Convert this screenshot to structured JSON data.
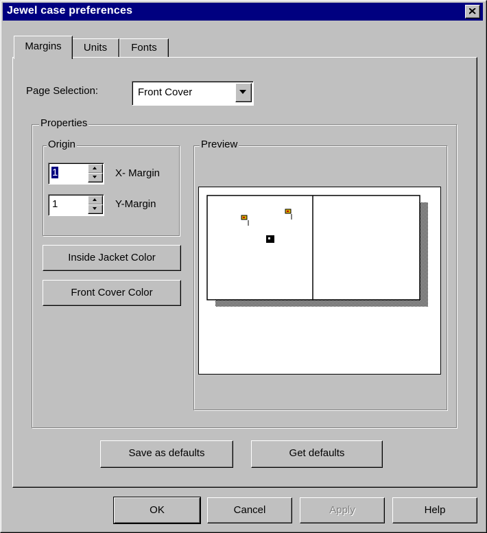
{
  "window": {
    "title": "Jewel case preferences"
  },
  "tabs": [
    {
      "label": "Margins",
      "active": true
    },
    {
      "label": "Units",
      "active": false
    },
    {
      "label": "Fonts",
      "active": false
    }
  ],
  "page_selection": {
    "label": "Page Selection:",
    "value": "Front Cover"
  },
  "properties": {
    "caption": "Properties",
    "origin": {
      "caption": "Origin",
      "x_margin": {
        "value": "1",
        "label": "X- Margin"
      },
      "y_margin": {
        "value": "1",
        "label": "Y-Margin"
      }
    },
    "inside_jacket_color_label": "Inside Jacket Color",
    "front_cover_color_label": "Front Cover Color",
    "preview_caption": "Preview"
  },
  "save_defaults_label": "Save as defaults",
  "get_defaults_label": "Get defaults",
  "footer": {
    "ok_label": "OK",
    "cancel_label": "Cancel",
    "apply_label": "Apply",
    "help_label": "Help"
  },
  "colors": {
    "titlebar": "#000080",
    "face": "#c0c0c0"
  }
}
